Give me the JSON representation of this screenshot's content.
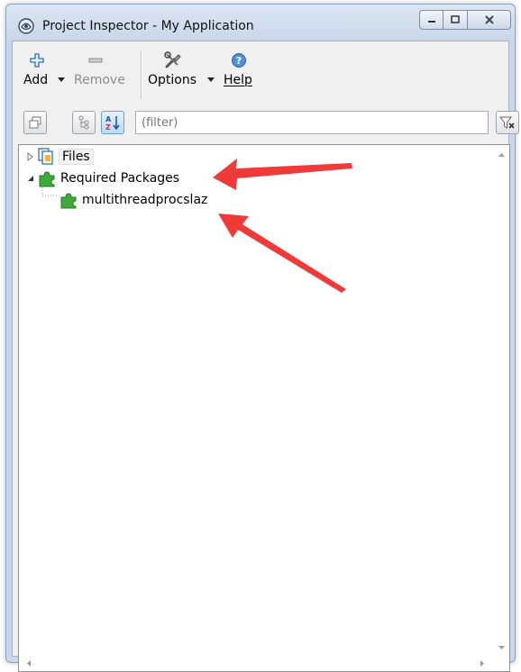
{
  "window": {
    "title": "Project Inspector - My Application"
  },
  "toolbar": {
    "add_label": "Add",
    "remove_label": "Remove",
    "options_label": "Options",
    "help_label": "Help"
  },
  "filter": {
    "placeholder": "(filter)"
  },
  "tree": {
    "files_label": "Files",
    "required_packages_label": "Required Packages",
    "package_label": "multithreadprocslaz"
  },
  "colors": {
    "arrow": "#f03a3a",
    "puzzle": "#3faa3a",
    "add_icon": "#2f6fb3",
    "frame": "#c9d7ea"
  }
}
